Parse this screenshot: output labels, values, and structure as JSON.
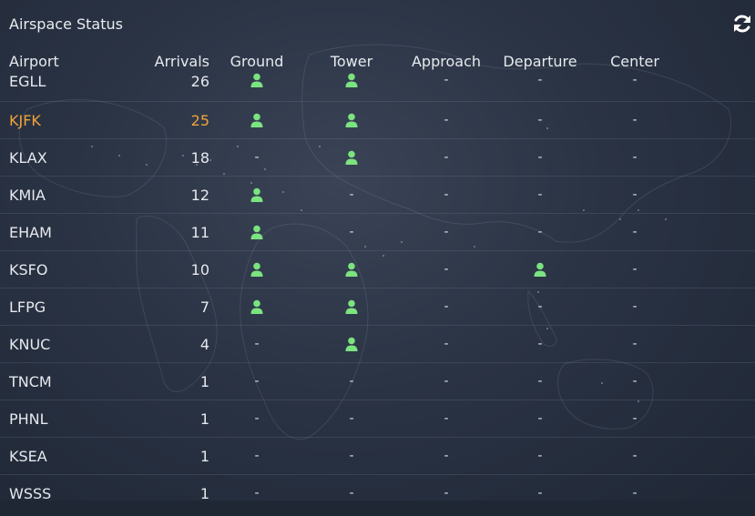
{
  "header": {
    "title": "Airspace Status",
    "refresh_icon": "refresh-icon"
  },
  "colors": {
    "accent": "#f0a33a",
    "online": "#7be37f",
    "background": "#2a3344"
  },
  "table": {
    "columns": [
      "Airport",
      "Arrivals",
      "Ground",
      "Tower",
      "Approach",
      "Departure",
      "Center"
    ],
    "empty_mark": "-",
    "rows": [
      {
        "airport": "EGLL",
        "arrivals": "26",
        "ground": true,
        "tower": true,
        "approach": false,
        "departure": false,
        "center": false,
        "selected": false
      },
      {
        "airport": "KJFK",
        "arrivals": "25",
        "ground": true,
        "tower": true,
        "approach": false,
        "departure": false,
        "center": false,
        "selected": true
      },
      {
        "airport": "KLAX",
        "arrivals": "18",
        "ground": false,
        "tower": true,
        "approach": false,
        "departure": false,
        "center": false,
        "selected": false
      },
      {
        "airport": "KMIA",
        "arrivals": "12",
        "ground": true,
        "tower": false,
        "approach": false,
        "departure": false,
        "center": false,
        "selected": false
      },
      {
        "airport": "EHAM",
        "arrivals": "11",
        "ground": true,
        "tower": false,
        "approach": false,
        "departure": false,
        "center": false,
        "selected": false
      },
      {
        "airport": "KSFO",
        "arrivals": "10",
        "ground": true,
        "tower": true,
        "approach": false,
        "departure": true,
        "center": false,
        "selected": false
      },
      {
        "airport": "LFPG",
        "arrivals": "7",
        "ground": true,
        "tower": true,
        "approach": false,
        "departure": false,
        "center": false,
        "selected": false
      },
      {
        "airport": "KNUC",
        "arrivals": "4",
        "ground": false,
        "tower": true,
        "approach": false,
        "departure": false,
        "center": false,
        "selected": false
      },
      {
        "airport": "TNCM",
        "arrivals": "1",
        "ground": false,
        "tower": false,
        "approach": false,
        "departure": false,
        "center": false,
        "selected": false
      },
      {
        "airport": "PHNL",
        "arrivals": "1",
        "ground": false,
        "tower": false,
        "approach": false,
        "departure": false,
        "center": false,
        "selected": false
      },
      {
        "airport": "KSEA",
        "arrivals": "1",
        "ground": false,
        "tower": false,
        "approach": false,
        "departure": false,
        "center": false,
        "selected": false
      },
      {
        "airport": "WSSS",
        "arrivals": "1",
        "ground": false,
        "tower": false,
        "approach": false,
        "departure": false,
        "center": false,
        "selected": false
      }
    ]
  }
}
